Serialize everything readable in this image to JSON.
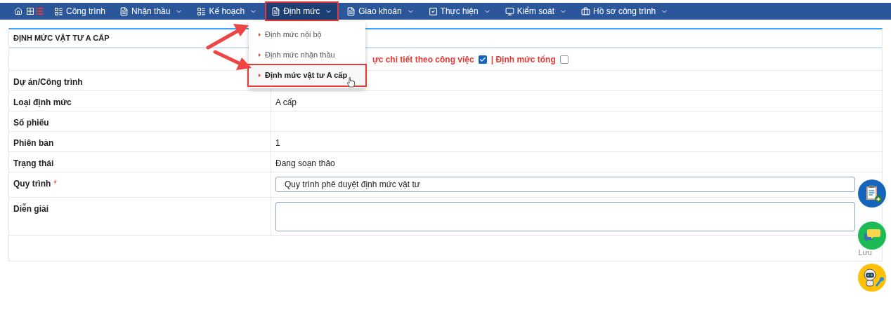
{
  "nav": {
    "items": [
      {
        "label": "Công trình",
        "dropdown": false,
        "selected": false
      },
      {
        "label": "Nhận thầu",
        "dropdown": true,
        "selected": false
      },
      {
        "label": "Kế hoạch",
        "dropdown": true,
        "selected": false
      },
      {
        "label": "Định mức",
        "dropdown": true,
        "selected": true
      },
      {
        "label": "Giao khoán",
        "dropdown": true,
        "selected": false
      },
      {
        "label": "Thực hiện",
        "dropdown": true,
        "selected": false
      },
      {
        "label": "Kiểm soát",
        "dropdown": true,
        "selected": false
      },
      {
        "label": "Hồ sơ công trình",
        "dropdown": true,
        "selected": false
      }
    ]
  },
  "menu": {
    "items": [
      {
        "label": "Định mức nội bộ",
        "selected": false
      },
      {
        "label": "Định mức nhận thầu",
        "selected": false
      },
      {
        "label": "Định mức vật tư A cấp",
        "selected": true
      }
    ]
  },
  "form": {
    "title": "ĐỊNH MỨC VẬT TƯ A CẤP",
    "options": [
      {
        "label": "ực chi tiết theo công việc",
        "checked": true
      },
      {
        "label": "| Định mức tổng",
        "checked": false
      }
    ],
    "rows": [
      {
        "label": "Dự án/Công trình",
        "kind": "text",
        "value": ""
      },
      {
        "label": "Loại định mức",
        "kind": "text",
        "value": "A cấp"
      },
      {
        "label": "Số phiếu",
        "kind": "text",
        "value": ""
      },
      {
        "label": "Phiên bản",
        "kind": "text",
        "value": "1"
      },
      {
        "label": "Trạng thái",
        "kind": "text",
        "value": "Đang soạn thảo"
      },
      {
        "label": "Quy trình",
        "kind": "select",
        "required_mark": "*",
        "value": "Quy trình phê duyệt định mức vật tư"
      },
      {
        "label": "Diễn giải",
        "kind": "textarea",
        "value": ""
      }
    ],
    "save_label": "Lưu"
  }
}
